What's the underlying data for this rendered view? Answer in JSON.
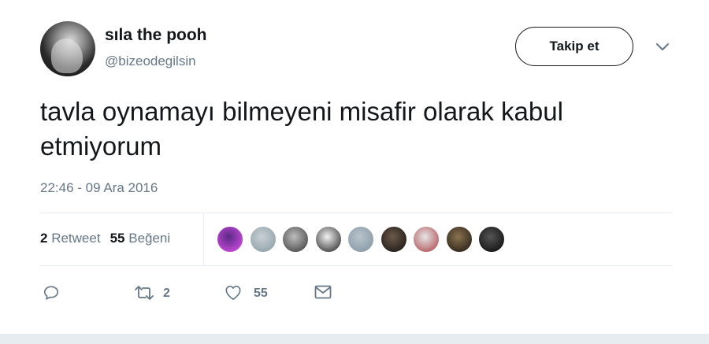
{
  "author": {
    "display_name": "sıla the pooh",
    "handle": "@bizeodegilsin"
  },
  "follow_button_label": "Takip et",
  "tweet": {
    "text": "tavla oynamayı bilmeyeni misafir olarak kabul etmiyorum",
    "timestamp": "22:46 - 09 Ara 2016"
  },
  "stats": {
    "retweet_count": "2",
    "retweet_label": "Retweet",
    "like_count": "55",
    "like_label": "Beğeni"
  },
  "liker_avatars": [
    {
      "colors": [
        "#5b2a86",
        "#cf4be0"
      ]
    },
    {
      "colors": [
        "#c9cfd6",
        "#8fa3a8"
      ]
    },
    {
      "colors": [
        "#bdbdbd",
        "#4a4a4a"
      ]
    },
    {
      "colors": [
        "#f2f2f2",
        "#3a3a3a"
      ]
    },
    {
      "colors": [
        "#b8c4cc",
        "#8899a6"
      ]
    },
    {
      "colors": [
        "#6b5a4a",
        "#1f1a16"
      ]
    },
    {
      "colors": [
        "#e6e6e6",
        "#b2565a"
      ]
    },
    {
      "colors": [
        "#8a7350",
        "#2a2218"
      ]
    },
    {
      "colors": [
        "#555555",
        "#111111"
      ]
    }
  ],
  "actions": {
    "retweet_count": "2",
    "like_count": "55"
  },
  "colors": {
    "text_primary": "#14171a",
    "text_secondary": "#657786",
    "divider": "#e6ecf0"
  }
}
